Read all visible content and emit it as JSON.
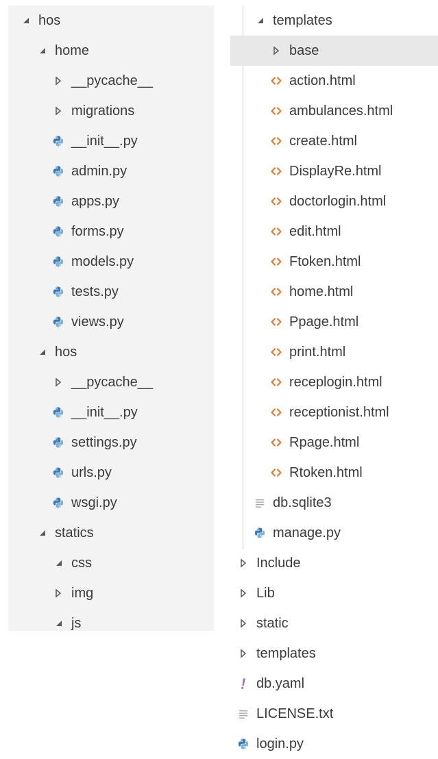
{
  "colors": {
    "left_background": "#f3f3f3",
    "selected_row": "#e8e8e8",
    "text": "#3b3b3b",
    "chevron": "#5a5a5a",
    "python_blue": "#3e7ab2",
    "python_light": "#7fb2da",
    "html_orange": "#e37933",
    "yaml_purple": "#a074c4",
    "lines_gray": "#a8a8a8"
  },
  "left_tree": [
    {
      "label": "hos",
      "depth": 0,
      "icon": "chevron-expanded-icon",
      "kind": "folder"
    },
    {
      "label": "home",
      "depth": 1,
      "icon": "chevron-expanded-icon",
      "kind": "folder"
    },
    {
      "label": "__pycache__",
      "depth": 2,
      "icon": "chevron-collapsed-icon",
      "kind": "folder"
    },
    {
      "label": "migrations",
      "depth": 2,
      "icon": "chevron-collapsed-icon",
      "kind": "folder"
    },
    {
      "label": "__init__.py",
      "depth": 2,
      "icon": "python-icon",
      "kind": "file"
    },
    {
      "label": "admin.py",
      "depth": 2,
      "icon": "python-icon",
      "kind": "file"
    },
    {
      "label": "apps.py",
      "depth": 2,
      "icon": "python-icon",
      "kind": "file"
    },
    {
      "label": "forms.py",
      "depth": 2,
      "icon": "python-icon",
      "kind": "file"
    },
    {
      "label": "models.py",
      "depth": 2,
      "icon": "python-icon",
      "kind": "file"
    },
    {
      "label": "tests.py",
      "depth": 2,
      "icon": "python-icon",
      "kind": "file"
    },
    {
      "label": "views.py",
      "depth": 2,
      "icon": "python-icon",
      "kind": "file"
    },
    {
      "label": "hos",
      "depth": 1,
      "icon": "chevron-expanded-icon",
      "kind": "folder"
    },
    {
      "label": "__pycache__",
      "depth": 2,
      "icon": "chevron-collapsed-icon",
      "kind": "folder"
    },
    {
      "label": "__init__.py",
      "depth": 2,
      "icon": "python-icon",
      "kind": "file"
    },
    {
      "label": "settings.py",
      "depth": 2,
      "icon": "python-icon",
      "kind": "file"
    },
    {
      "label": "urls.py",
      "depth": 2,
      "icon": "python-icon",
      "kind": "file"
    },
    {
      "label": "wsgi.py",
      "depth": 2,
      "icon": "python-icon",
      "kind": "file"
    },
    {
      "label": "statics",
      "depth": 1,
      "icon": "chevron-expanded-icon",
      "kind": "folder"
    },
    {
      "label": "css",
      "depth": 2,
      "icon": "chevron-expanded-icon",
      "kind": "folder"
    },
    {
      "label": "img",
      "depth": 2,
      "icon": "chevron-collapsed-icon",
      "kind": "folder"
    },
    {
      "label": "js",
      "depth": 2,
      "icon": "chevron-expanded-icon",
      "kind": "folder"
    }
  ],
  "right_tree": [
    {
      "label": "templates",
      "depth": 1,
      "icon": "chevron-expanded-icon",
      "kind": "folder"
    },
    {
      "label": "base",
      "depth": 2,
      "icon": "chevron-collapsed-icon",
      "kind": "folder",
      "selected": true
    },
    {
      "label": "action.html",
      "depth": 2,
      "icon": "html-icon",
      "kind": "file"
    },
    {
      "label": "ambulances.html",
      "depth": 2,
      "icon": "html-icon",
      "kind": "file"
    },
    {
      "label": "create.html",
      "depth": 2,
      "icon": "html-icon",
      "kind": "file"
    },
    {
      "label": "DisplayRe.html",
      "depth": 2,
      "icon": "html-icon",
      "kind": "file"
    },
    {
      "label": "doctorlogin.html",
      "depth": 2,
      "icon": "html-icon",
      "kind": "file"
    },
    {
      "label": "edit.html",
      "depth": 2,
      "icon": "html-icon",
      "kind": "file"
    },
    {
      "label": "Ftoken.html",
      "depth": 2,
      "icon": "html-icon",
      "kind": "file"
    },
    {
      "label": "home.html",
      "depth": 2,
      "icon": "html-icon",
      "kind": "file"
    },
    {
      "label": "Ppage.html",
      "depth": 2,
      "icon": "html-icon",
      "kind": "file"
    },
    {
      "label": "print.html",
      "depth": 2,
      "icon": "html-icon",
      "kind": "file"
    },
    {
      "label": "receplogin.html",
      "depth": 2,
      "icon": "html-icon",
      "kind": "file"
    },
    {
      "label": "receptionist.html",
      "depth": 2,
      "icon": "html-icon",
      "kind": "file"
    },
    {
      "label": "Rpage.html",
      "depth": 2,
      "icon": "html-icon",
      "kind": "file"
    },
    {
      "label": "Rtoken.html",
      "depth": 2,
      "icon": "html-icon",
      "kind": "file"
    },
    {
      "label": "db.sqlite3",
      "depth": 1,
      "icon": "lines-icon",
      "kind": "file"
    },
    {
      "label": "manage.py",
      "depth": 1,
      "icon": "python-icon",
      "kind": "file"
    },
    {
      "label": "Include",
      "depth": 0,
      "icon": "chevron-collapsed-icon",
      "kind": "folder"
    },
    {
      "label": "Lib",
      "depth": 0,
      "icon": "chevron-collapsed-icon",
      "kind": "folder"
    },
    {
      "label": "static",
      "depth": 0,
      "icon": "chevron-collapsed-icon",
      "kind": "folder"
    },
    {
      "label": "templates",
      "depth": 0,
      "icon": "chevron-collapsed-icon",
      "kind": "folder"
    },
    {
      "label": "db.yaml",
      "depth": 0,
      "icon": "yaml-icon",
      "kind": "file"
    },
    {
      "label": "LICENSE.txt",
      "depth": 0,
      "icon": "lines-icon",
      "kind": "file"
    },
    {
      "label": "login.py",
      "depth": 0,
      "icon": "python-icon",
      "kind": "file"
    }
  ]
}
